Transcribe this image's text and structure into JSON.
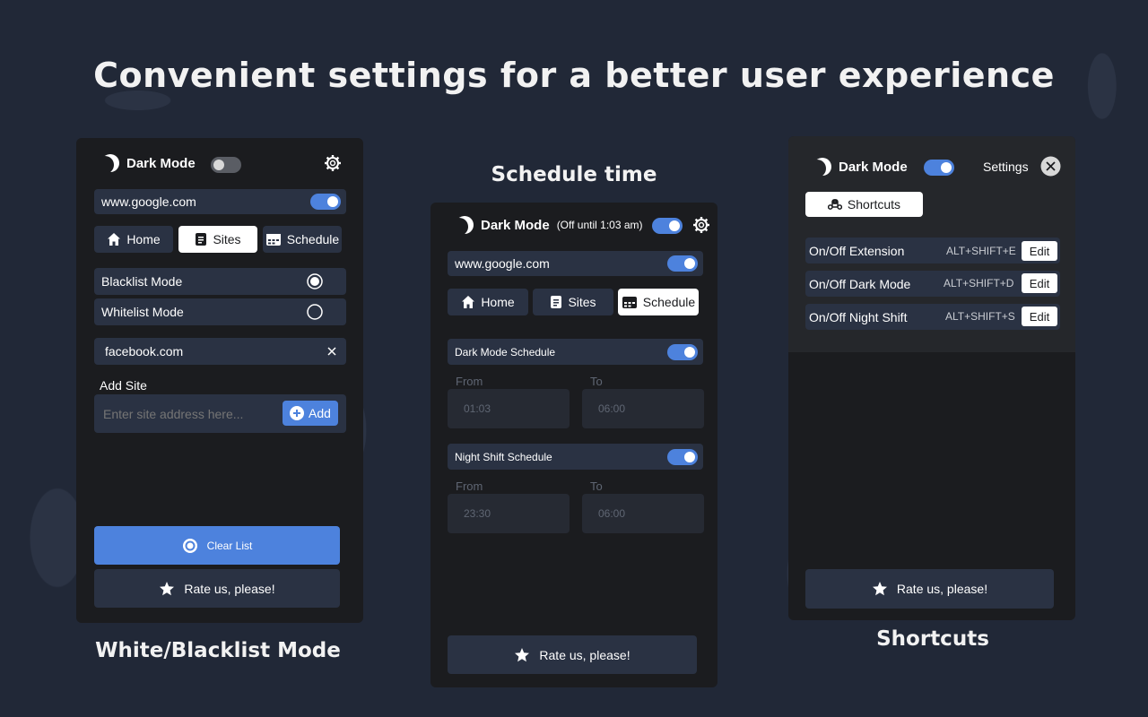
{
  "headline": "Convenient settings for a better user experience",
  "captions": {
    "left": "White/Blacklist Mode",
    "center": "Schedule time",
    "right": "Shortcuts"
  },
  "left_panel": {
    "brand": "Dark Mode",
    "site_row": "www.google.com",
    "tabs": [
      "Home",
      "Sites",
      "Schedule"
    ],
    "active_tab": "Sites",
    "modes": [
      "Blacklist Mode",
      "Whitelist Mode"
    ],
    "selected_mode": "Blacklist Mode",
    "listed_site": "facebook.com",
    "add_site_label": "Add Site",
    "add_site_placeholder": "Enter site address here...",
    "add_button": "Add",
    "clear_button": "Clear List",
    "rate_button": "Rate us, please!"
  },
  "center_panel": {
    "brand": "Dark Mode",
    "brand_note": "(Off until 1:03 am)",
    "site_row": "www.google.com",
    "tabs": [
      "Home",
      "Sites",
      "Schedule"
    ],
    "active_tab": "Schedule",
    "dark_schedule": {
      "label": "Dark Mode Schedule",
      "from_label": "From",
      "to_label": "To",
      "from": "01:03",
      "to": "06:00"
    },
    "night_schedule": {
      "label": "Night Shift Schedule",
      "from_label": "From",
      "to_label": "To",
      "from": "23:30",
      "to": "06:00"
    },
    "rate_button": "Rate us, please!"
  },
  "right_panel": {
    "brand": "Dark Mode",
    "settings_label": "Settings",
    "shortcuts_tab": "Shortcuts",
    "shortcuts": [
      {
        "name": "On/Off Extension",
        "keys": "ALT+SHIFT+E",
        "edit": "Edit"
      },
      {
        "name": "On/Off Dark Mode",
        "keys": "ALT+SHIFT+D",
        "edit": "Edit"
      },
      {
        "name": "On/Off Night Shift",
        "keys": "ALT+SHIFT+S",
        "edit": "Edit"
      }
    ],
    "rate_button": "Rate us, please!"
  },
  "colors": {
    "accent": "#4d82dd",
    "panel": "#1b1c1f",
    "row": "#2a3243",
    "background": "#212837"
  }
}
